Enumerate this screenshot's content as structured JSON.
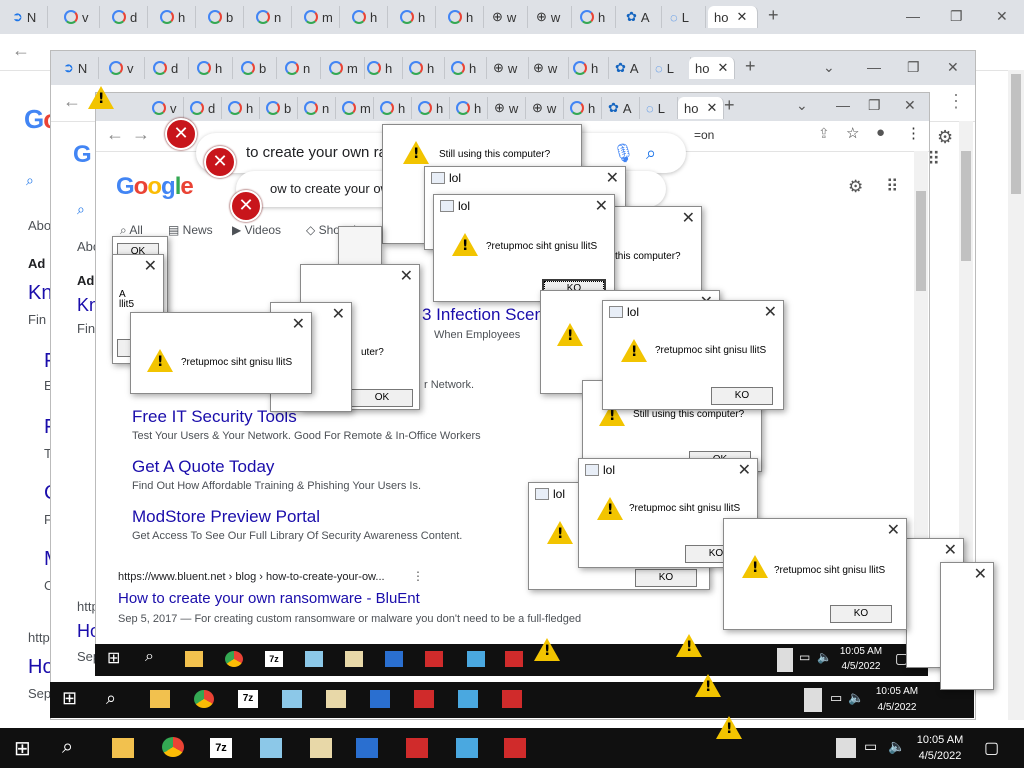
{
  "tabs": {
    "t1": "N",
    "t2": "v",
    "t3": "d",
    "t4": "h",
    "t5": "b",
    "t6": "n",
    "t7": "m",
    "t8": "h",
    "t9": "h",
    "t10": "h",
    "t11": "w",
    "t12": "w",
    "t13": "h",
    "t14": "A",
    "t15": "L",
    "active": "ho"
  },
  "search": {
    "query": "to create your own ran",
    "query_partial": "ow to create your own"
  },
  "google": {
    "logo": "Google",
    "filter_all": "All",
    "filter_news": "News",
    "filter_videos": "Videos",
    "filter_shopping": "Shopping",
    "about_label": "Abo",
    "ad_label": "Ad"
  },
  "ads": {
    "infection_title": "3 Infection Scena",
    "infection_desc": "When Employees",
    "network_desc": "r Network.",
    "free_it_title": "Free IT Security Tools",
    "free_it_desc": "Test Your Users & Your Network. Good For Remote & In-Office Workers",
    "quote_title": "Get A Quote Today",
    "quote_desc": "Find Out How Affordable Training & Phishing Your Users Is.",
    "modstore_title": "ModStore Preview Portal",
    "modstore_desc": "Get Access To See Our Full Library Of Security Awareness Content."
  },
  "result": {
    "url": "https://www.bluent.net › blog › how-to-create-your-ow...",
    "title": "How to create your own ransomware - BluEnt",
    "snippet": "Sep 5, 2017 — For creating custom ransomware or malware you don't need to be a full-fledged",
    "http_fragment": "http",
    "ho_fragment": "Ho",
    "sep_fragment": "Sep"
  },
  "left_fragments": {
    "kn": "Kn",
    "fin": "Fin",
    "f": "F",
    "e": "E",
    "t": "T",
    "c": "C",
    "m": "M"
  },
  "omnibox": {
    "tail": "=on"
  },
  "dialogs": {
    "title": "lol",
    "message": "?retupmoc siht gnisu llitS",
    "message_small": "?retupmoc siht gnisu llitS",
    "message_normal": "Still using this computer?",
    "message_fragment": "this computer?",
    "message_fragment2": "uter?",
    "ok": "OK",
    "ok_reversed": "KO",
    "stil_fragment": "llit5",
    "a_fragment": "A",
    "k_fragment": "K",
    "ok_fragment": "OK"
  },
  "taskbar": {
    "time": "10:05 AM",
    "date": "4/5/2022",
    "time_small": "10:05 AM",
    "date_small": "4/5/2022"
  }
}
